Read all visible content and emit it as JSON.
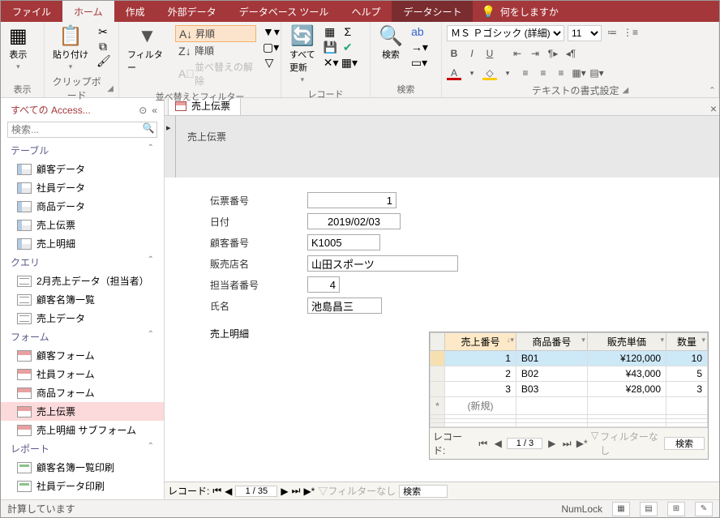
{
  "menu": {
    "file": "ファイル",
    "home": "ホーム",
    "create": "作成",
    "external": "外部データ",
    "dbtools": "データベース ツール",
    "help": "ヘルプ",
    "datasheet": "データシート",
    "tellme": "何をしますか"
  },
  "ribbon": {
    "view": "表示",
    "paste": "貼り付け",
    "clipboard": "クリップボード",
    "filter": "フィルター",
    "asc": "昇順",
    "desc": "降順",
    "clearsort": "並べ替えの解除",
    "sortfilter": "並べ替えとフィルター",
    "refresh": "すべて\n更新",
    "records": "レコード",
    "find": "検索",
    "findgrp": "検索",
    "fontname": "ＭＳ Ｐゴシック (詳細)",
    "fontsize": "11",
    "textfmt": "テキストの書式設定"
  },
  "nav": {
    "title": "すべての Access...",
    "searchph": "検索...",
    "cats": {
      "tables": "テーブル",
      "queries": "クエリ",
      "forms": "フォーム",
      "reports": "レポート"
    },
    "tables": [
      "顧客データ",
      "社員データ",
      "商品データ",
      "売上伝票",
      "売上明細"
    ],
    "queries": [
      "2月売上データ（担当者）",
      "顧客名簿一覧",
      "売上データ"
    ],
    "forms": [
      "顧客フォーム",
      "社員フォーム",
      "商品フォーム",
      "売上伝票",
      "売上明細 サブフォーム"
    ],
    "reports": [
      "顧客名簿一覧印刷",
      "社員データ印刷"
    ]
  },
  "doc": {
    "tab": "売上伝票",
    "title": "売上伝票",
    "labels": {
      "slipno": "伝票番号",
      "date": "日付",
      "custno": "顧客番号",
      "store": "販売店名",
      "staffno": "担当者番号",
      "staffname": "氏名",
      "detail": "売上明細"
    },
    "vals": {
      "slipno": "1",
      "date": "2019/02/03",
      "custno": "K1005",
      "store": "山田スポーツ",
      "staffno": "4",
      "staffname": "池島昌三"
    },
    "grid": {
      "cols": {
        "saleno": "売上番号",
        "prodno": "商品番号",
        "price": "販売単価",
        "qty": "数量"
      },
      "rows": [
        {
          "saleno": "1",
          "prodno": "B01",
          "price": "¥120,000",
          "qty": "10"
        },
        {
          "saleno": "2",
          "prodno": "B02",
          "price": "¥43,000",
          "qty": "5"
        },
        {
          "saleno": "3",
          "prodno": "B03",
          "price": "¥28,000",
          "qty": "3"
        }
      ],
      "newrow": "(新規)"
    },
    "subnav": {
      "label": "レコード:",
      "pos": "1 / 3",
      "nofilter": "フィルターなし",
      "search": "検索"
    },
    "outnav": {
      "label": "レコード:",
      "pos": "1 / 35",
      "nofilter": "フィルターなし",
      "search": "検索"
    }
  },
  "status": {
    "msg": "計算しています",
    "numlock": "NumLock"
  }
}
